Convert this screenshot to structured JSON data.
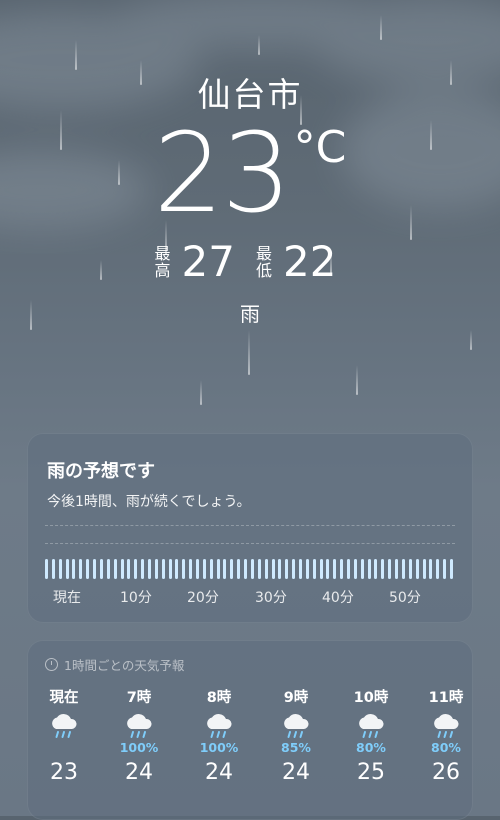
{
  "location": {
    "city": "仙台市",
    "temperature": "23",
    "unit": "°C",
    "high_label": "最高",
    "high": "27",
    "low_label": "最低",
    "low": "22",
    "condition": "雨"
  },
  "rain_forecast": {
    "title": "雨の予想です",
    "subtitle": "今後1時間、雨が続くでしょう。",
    "intensity_level": 1.0,
    "time_labels": [
      "現在",
      "10分",
      "20分",
      "30分",
      "40分",
      "50分"
    ]
  },
  "hourly": {
    "header": "1時間ごとの天気予報",
    "items": [
      {
        "time": "現在",
        "icon": "rain-cloud-icon",
        "precip": "",
        "temp": "23"
      },
      {
        "time": "7時",
        "icon": "rain-cloud-icon",
        "precip": "100%",
        "temp": "24"
      },
      {
        "time": "8時",
        "icon": "rain-cloud-icon",
        "precip": "100%",
        "temp": "24"
      },
      {
        "time": "9時",
        "icon": "rain-cloud-icon",
        "precip": "85%",
        "temp": "24"
      },
      {
        "time": "10時",
        "icon": "rain-cloud-icon",
        "precip": "80%",
        "temp": "25"
      },
      {
        "time": "11時",
        "icon": "rain-cloud-icon",
        "precip": "80%",
        "temp": "26"
      }
    ]
  },
  "colors": {
    "precip_text": "#7fcdfa",
    "rain_bar": "#cfeaff"
  }
}
